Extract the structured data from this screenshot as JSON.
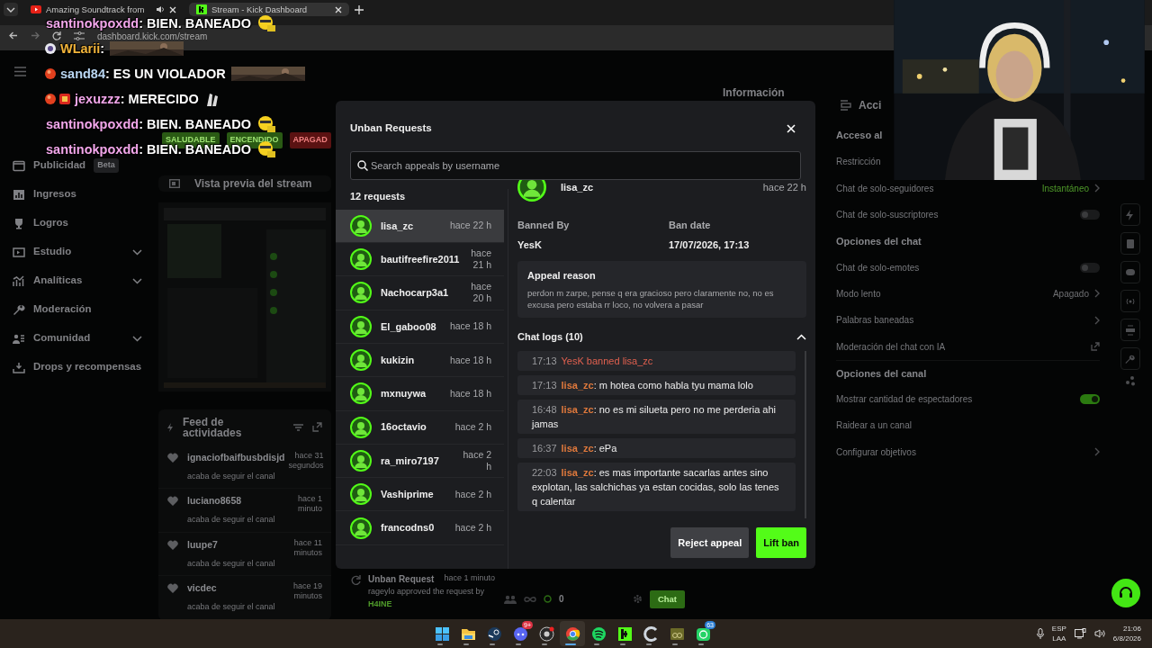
{
  "browser": {
    "tabs": [
      {
        "title": "Amazing Soundtrack from",
        "kind": "video",
        "audio": true,
        "selected": false
      },
      {
        "title": "Stream - Kick Dashboard",
        "kind": "kick",
        "audio": false,
        "selected": true
      }
    ],
    "url": "dashboard.kick.com/stream"
  },
  "sidebar": {
    "items": [
      {
        "label": "Publicidad",
        "badge": "Beta",
        "expandable": false
      },
      {
        "label": "Ingresos",
        "expandable": false
      },
      {
        "label": "Logros",
        "expandable": false
      },
      {
        "label": "Estudio",
        "expandable": true
      },
      {
        "label": "Analíticas",
        "expandable": true
      },
      {
        "label": "Moderación",
        "expandable": false
      },
      {
        "label": "Comunidad",
        "expandable": true
      },
      {
        "label": "Drops y recompensas",
        "expandable": false
      }
    ]
  },
  "status_badges": [
    {
      "label": "SALUDABLE",
      "color": "#2a5a14"
    },
    {
      "label": "ENCENDIDO",
      "color": "#2a5a14"
    },
    {
      "label": "APAGAD",
      "color": "#5a1212"
    }
  ],
  "preview": {
    "title": "Vista previa del stream"
  },
  "activity_feed": {
    "title": "Feed de actividades",
    "items": [
      {
        "user": "ignaciofbaifbusbdisjd",
        "time": "hace 31 segundos",
        "action": "acaba de seguir el canal"
      },
      {
        "user": "luciano8658",
        "time": "hace 1 minuto",
        "action": "acaba de seguir el canal"
      },
      {
        "user": "luupe7",
        "time": "hace 11 minutos",
        "action": "acaba de seguir el canal"
      },
      {
        "user": "vicdec",
        "time": "hace 19 minutos",
        "action": "acaba de seguir el canal"
      }
    ]
  },
  "unban_notice": {
    "title": "Unban Request",
    "time": "hace 1 minuto",
    "detail": "rageylo approved the request by",
    "by": "H4INE"
  },
  "chat_bar": {
    "count": "0",
    "send": "Chat"
  },
  "info_header": "Información",
  "settings": {
    "header": "Acci",
    "rows": [
      {
        "kind": "heading",
        "label": "Acceso al"
      },
      {
        "kind": "plain",
        "label": "Restricción"
      },
      {
        "kind": "value",
        "label": "Chat de solo-seguidores",
        "value": "Instantáneo"
      },
      {
        "kind": "toggle",
        "label": "Chat de solo-suscriptores",
        "on": false
      },
      {
        "kind": "heading",
        "label": "Opciones del chat"
      },
      {
        "kind": "toggle",
        "label": "Chat de solo-emotes",
        "on": false
      },
      {
        "kind": "value",
        "label": "Modo lento",
        "value": "Apagado"
      },
      {
        "kind": "link",
        "label": "Palabras baneadas"
      },
      {
        "kind": "external",
        "label": "Moderación del chat con IA"
      },
      {
        "kind": "heading",
        "label": "Opciones del canal"
      },
      {
        "kind": "toggle",
        "label": "Mostrar cantidad de espectadores",
        "on": true
      },
      {
        "kind": "plain",
        "label": "Raidear a un canal"
      },
      {
        "kind": "link",
        "label": "Configurar objetivos"
      }
    ]
  },
  "modal": {
    "title": "Unban Requests",
    "search": {
      "placeholder": "Search appeals by username"
    },
    "count": "12 requests",
    "requests": [
      {
        "name": "lisa_zc",
        "time": "hace 22 h",
        "selected": true
      },
      {
        "name": "bautifreefire2011",
        "time": "hace 21 h",
        "selected": false
      },
      {
        "name": "Nachocarp3a1",
        "time": "hace 20 h",
        "selected": false
      },
      {
        "name": "El_gaboo08",
        "time": "hace 18 h",
        "selected": false
      },
      {
        "name": "kukizin",
        "time": "hace 18 h",
        "selected": false
      },
      {
        "name": "mxnuywa",
        "time": "hace 18 h",
        "selected": false
      },
      {
        "name": "16octavio",
        "time": "hace 2 h",
        "selected": false
      },
      {
        "name": "ra_miro7197",
        "time": "hace 2 h",
        "selected": false
      },
      {
        "name": "Vashiprime",
        "time": "hace 2 h",
        "selected": false
      },
      {
        "name": "francodns0",
        "time": "hace 2 h",
        "selected": false
      }
    ],
    "detail": {
      "name": "lisa_zc",
      "time": "hace 22 h",
      "banned_by_label": "Banned By",
      "banned_by": "YesK",
      "ban_date_label": "Ban date",
      "ban_date": "17/07/2026, 17:13",
      "reason_title": "Appeal reason",
      "reason": "perdon m zarpe, pense q era gracioso pero claramente no, no es excusa pero estaba rr loco, no volvera a pasar",
      "logs_title": "Chat logs (10)",
      "logs_expanded": true,
      "logs": [
        {
          "kind": "system",
          "time": "17:13",
          "text": "YesK banned lisa_zc"
        },
        {
          "kind": "message",
          "time": "17:13",
          "user": "lisa_zc",
          "text": ": m hotea como habla tyu mama lolo"
        },
        {
          "kind": "message",
          "time": "16:48",
          "user": "lisa_zc",
          "text": ": no es mi silueta pero no me perderia ahi jamas"
        },
        {
          "kind": "message",
          "time": "16:37",
          "user": "lisa_zc",
          "text": ": ePa"
        },
        {
          "kind": "message",
          "time": "22:03",
          "user": "lisa_zc",
          "text": ": es mas importante sacarlas antes sino explotan, las salchichas ya estan cocidas, solo las tenes q calentar"
        }
      ]
    },
    "buttons": [
      {
        "label": "Reject appeal",
        "kind": "secondary"
      },
      {
        "label": "Lift ban",
        "kind": "primary"
      }
    ]
  },
  "chat_overlay": {
    "lines": [
      {
        "user": "santinokpoxdd",
        "color": "#f2a6ea",
        "text": ": BIEN. BANEADO",
        "emote": {
          "kind": "smiley"
        }
      },
      {
        "badges": [
          {
            "kind": "round"
          }
        ],
        "user": "WLarii",
        "color": "#f1b43a",
        "text": ":",
        "emote": {
          "kind": "picture"
        }
      },
      {
        "badges": [
          {
            "kind": "red"
          }
        ],
        "user": "sand84",
        "color": "#b9d6f2",
        "text": ": ES UN VIOLADOR",
        "emote": {
          "kind": "picture"
        }
      },
      {
        "badges": [
          {
            "kind": "red"
          },
          {
            "kind": "square"
          }
        ],
        "user": "jexuzzz",
        "color": "#f2a6ea",
        "text": ": MERECIDO",
        "emote": {
          "kind": "hands"
        }
      },
      {
        "user": "santinokpoxdd",
        "color": "#f2a6ea",
        "text": ": BIEN. BANEADO",
        "emote": {
          "kind": "smiley"
        }
      },
      {
        "user": "santinokpoxdd",
        "color": "#f2a6ea",
        "text": ": BIEN. BANEADO",
        "emote": {
          "kind": "smiley"
        }
      }
    ]
  },
  "taskbar": {
    "apps": [
      {
        "kind": "start",
        "selected": false
      },
      {
        "kind": "folder",
        "selected": false
      },
      {
        "kind": "steam",
        "selected": false
      },
      {
        "kind": "discord",
        "badge": "9+",
        "selected": false
      },
      {
        "kind": "obs",
        "selected": false
      },
      {
        "kind": "browser",
        "selected": true
      },
      {
        "kind": "music",
        "selected": false
      },
      {
        "kind": "kick",
        "selected": false
      },
      {
        "kind": "cleaner",
        "selected": false
      },
      {
        "kind": "app",
        "selected": false
      },
      {
        "kind": "chat",
        "badge": "63",
        "selected": false
      }
    ],
    "tray": {
      "lang": "ESP",
      "layout": "LAA",
      "time": "21:06",
      "date": "6/8/2026"
    }
  }
}
